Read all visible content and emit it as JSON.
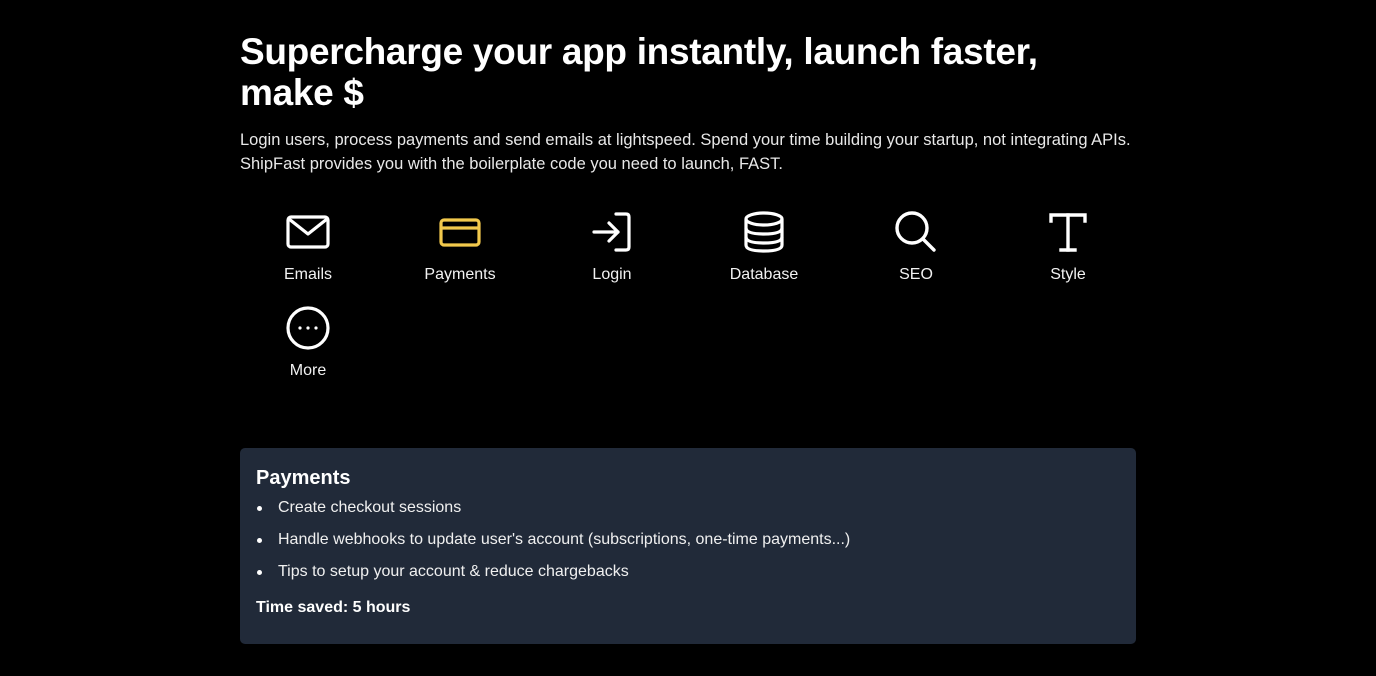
{
  "hero": {
    "title": "Supercharge your app instantly, launch faster, make $",
    "description": "Login users, process payments and send emails at lightspeed. Spend your time building your startup, not integrating APIs. ShipFast provides you with the boilerplate code you need to launch, FAST."
  },
  "features": [
    {
      "label": "Emails",
      "icon": "mail-icon"
    },
    {
      "label": "Payments",
      "icon": "credit-card-icon"
    },
    {
      "label": "Login",
      "icon": "login-icon"
    },
    {
      "label": "Database",
      "icon": "database-icon"
    },
    {
      "label": "SEO",
      "icon": "search-icon"
    },
    {
      "label": "Style",
      "icon": "text-style-icon"
    },
    {
      "label": "More",
      "icon": "more-icon"
    }
  ],
  "selected_feature": "Payments",
  "colors": {
    "background": "#000000",
    "accent": "#f2c94c",
    "panel": "#212a39"
  },
  "panel": {
    "title": "Payments",
    "items": [
      "Create checkout sessions",
      "Handle webhooks to update user's account (subscriptions, one-time payments...)",
      "Tips to setup your account & reduce chargebacks"
    ],
    "time_saved": "Time saved: 5 hours"
  }
}
